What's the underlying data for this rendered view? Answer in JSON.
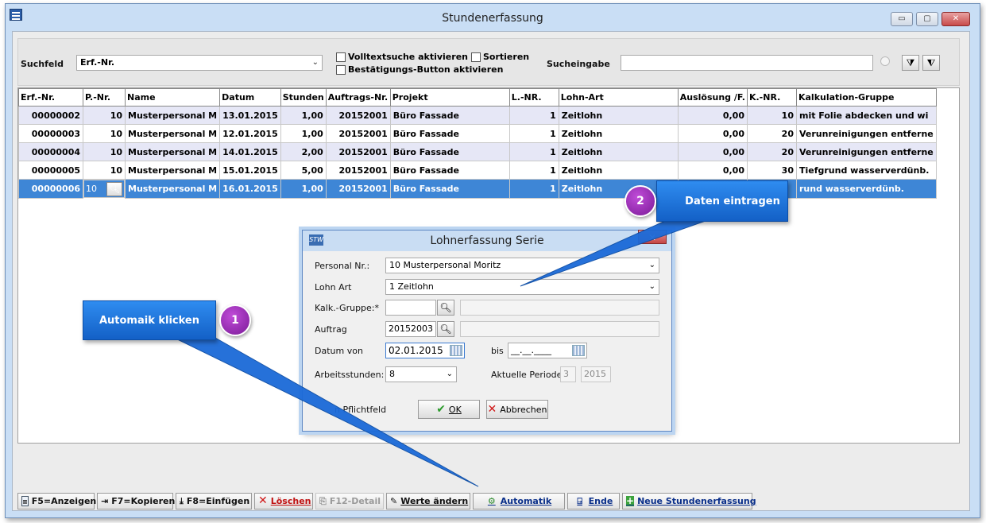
{
  "window": {
    "title": "Stundenerfassung"
  },
  "filter": {
    "suchfeld_label": "Suchfeld",
    "suchfeld_value": "Erf.-Nr.",
    "volltext_label": "Volltextsuche aktivieren",
    "sortieren_label": "Sortieren",
    "bestaetigung_label": "Bestätigungs-Button aktivieren",
    "sucheingabe_label": "Sucheingabe",
    "sucheingabe_value": ""
  },
  "table": {
    "columns": [
      "Erf.-Nr.",
      "P.-Nr.",
      "Name",
      "Datum",
      "Stunden",
      "Auftrags-Nr.",
      "Projekt",
      "L.-NR.",
      "Lohn-Art",
      "Auslösung /F.",
      "K.-NR.",
      "Kalkulation-Gruppe"
    ],
    "rows": [
      [
        "00000002",
        "10",
        "Musterpersonal M",
        "13.01.2015",
        "1,00",
        "20152001",
        "Büro Fassade",
        "1",
        "Zeitlohn",
        "0,00",
        "10",
        "mit Folie abdecken und wi"
      ],
      [
        "00000003",
        "10",
        "Musterpersonal M",
        "12.01.2015",
        "1,00",
        "20152001",
        "Büro Fassade",
        "1",
        "Zeitlohn",
        "0,00",
        "20",
        "Verunreinigungen entferne"
      ],
      [
        "00000004",
        "10",
        "Musterpersonal M",
        "14.01.2015",
        "2,00",
        "20152001",
        "Büro Fassade",
        "1",
        "Zeitlohn",
        "0,00",
        "20",
        "Verunreinigungen entferne"
      ],
      [
        "00000005",
        "10",
        "Musterpersonal M",
        "15.01.2015",
        "5,00",
        "20152001",
        "Büro Fassade",
        "1",
        "Zeitlohn",
        "0,00",
        "30",
        "Tiefgrund wasserverdünb."
      ],
      [
        "00000006",
        "10",
        "Musterpersonal M",
        "16.01.2015",
        "1,00",
        "20152001",
        "Büro Fassade",
        "1",
        "Zeitlohn",
        "",
        "",
        "rund wasserverdünb."
      ]
    ]
  },
  "toolbar": {
    "f5": "F5=Anzeigen",
    "f7": "F7=Kopieren",
    "f8": "F8=Einfügen",
    "loeschen": "Löschen",
    "f12": "F12-Detail",
    "werte": "Werte ändern",
    "automatik": "Automatik",
    "ende": "Ende",
    "neue": "Neue Stundenerfassung"
  },
  "dialog": {
    "icon_text": "STW",
    "title": "Lohnerfassung Serie",
    "personal_label": "Personal Nr.:",
    "personal_value": "10 Musterpersonal Moritz",
    "lohnart_label": "Lohn Art",
    "lohnart_value": "1 Zeitlohn",
    "kalk_label": "Kalk.-Gruppe:*",
    "kalk_value": "",
    "kalk_desc": "",
    "auftrag_label": "Auftrag",
    "auftrag_value": "20152003",
    "auftrag_desc": "",
    "datum_von_label": "Datum von",
    "datum_von_value": "02.01.2015",
    "bis_label": "bis",
    "bis_value": "__.__.____",
    "arbeitsstunden_label": "Arbeitsstunden:",
    "arbeitsstunden_value": "8",
    "periode_label": "Aktuelle Periode:",
    "periode_month": "3",
    "periode_year": "2015",
    "pflicht_text": "n Pflichtfeld",
    "ok_label": "OK",
    "abbrechen_label": "Abbrechen"
  },
  "callouts": {
    "step1_number": "1",
    "step1_text": "Automaik klicken",
    "step2_number": "2",
    "step2_text": "Daten eintragen"
  },
  "colors": {
    "selected_row": "#3e86d6",
    "alt_row": "#e6e7f6",
    "callout": "#1f77e0",
    "badge": "#9b2fbf"
  }
}
